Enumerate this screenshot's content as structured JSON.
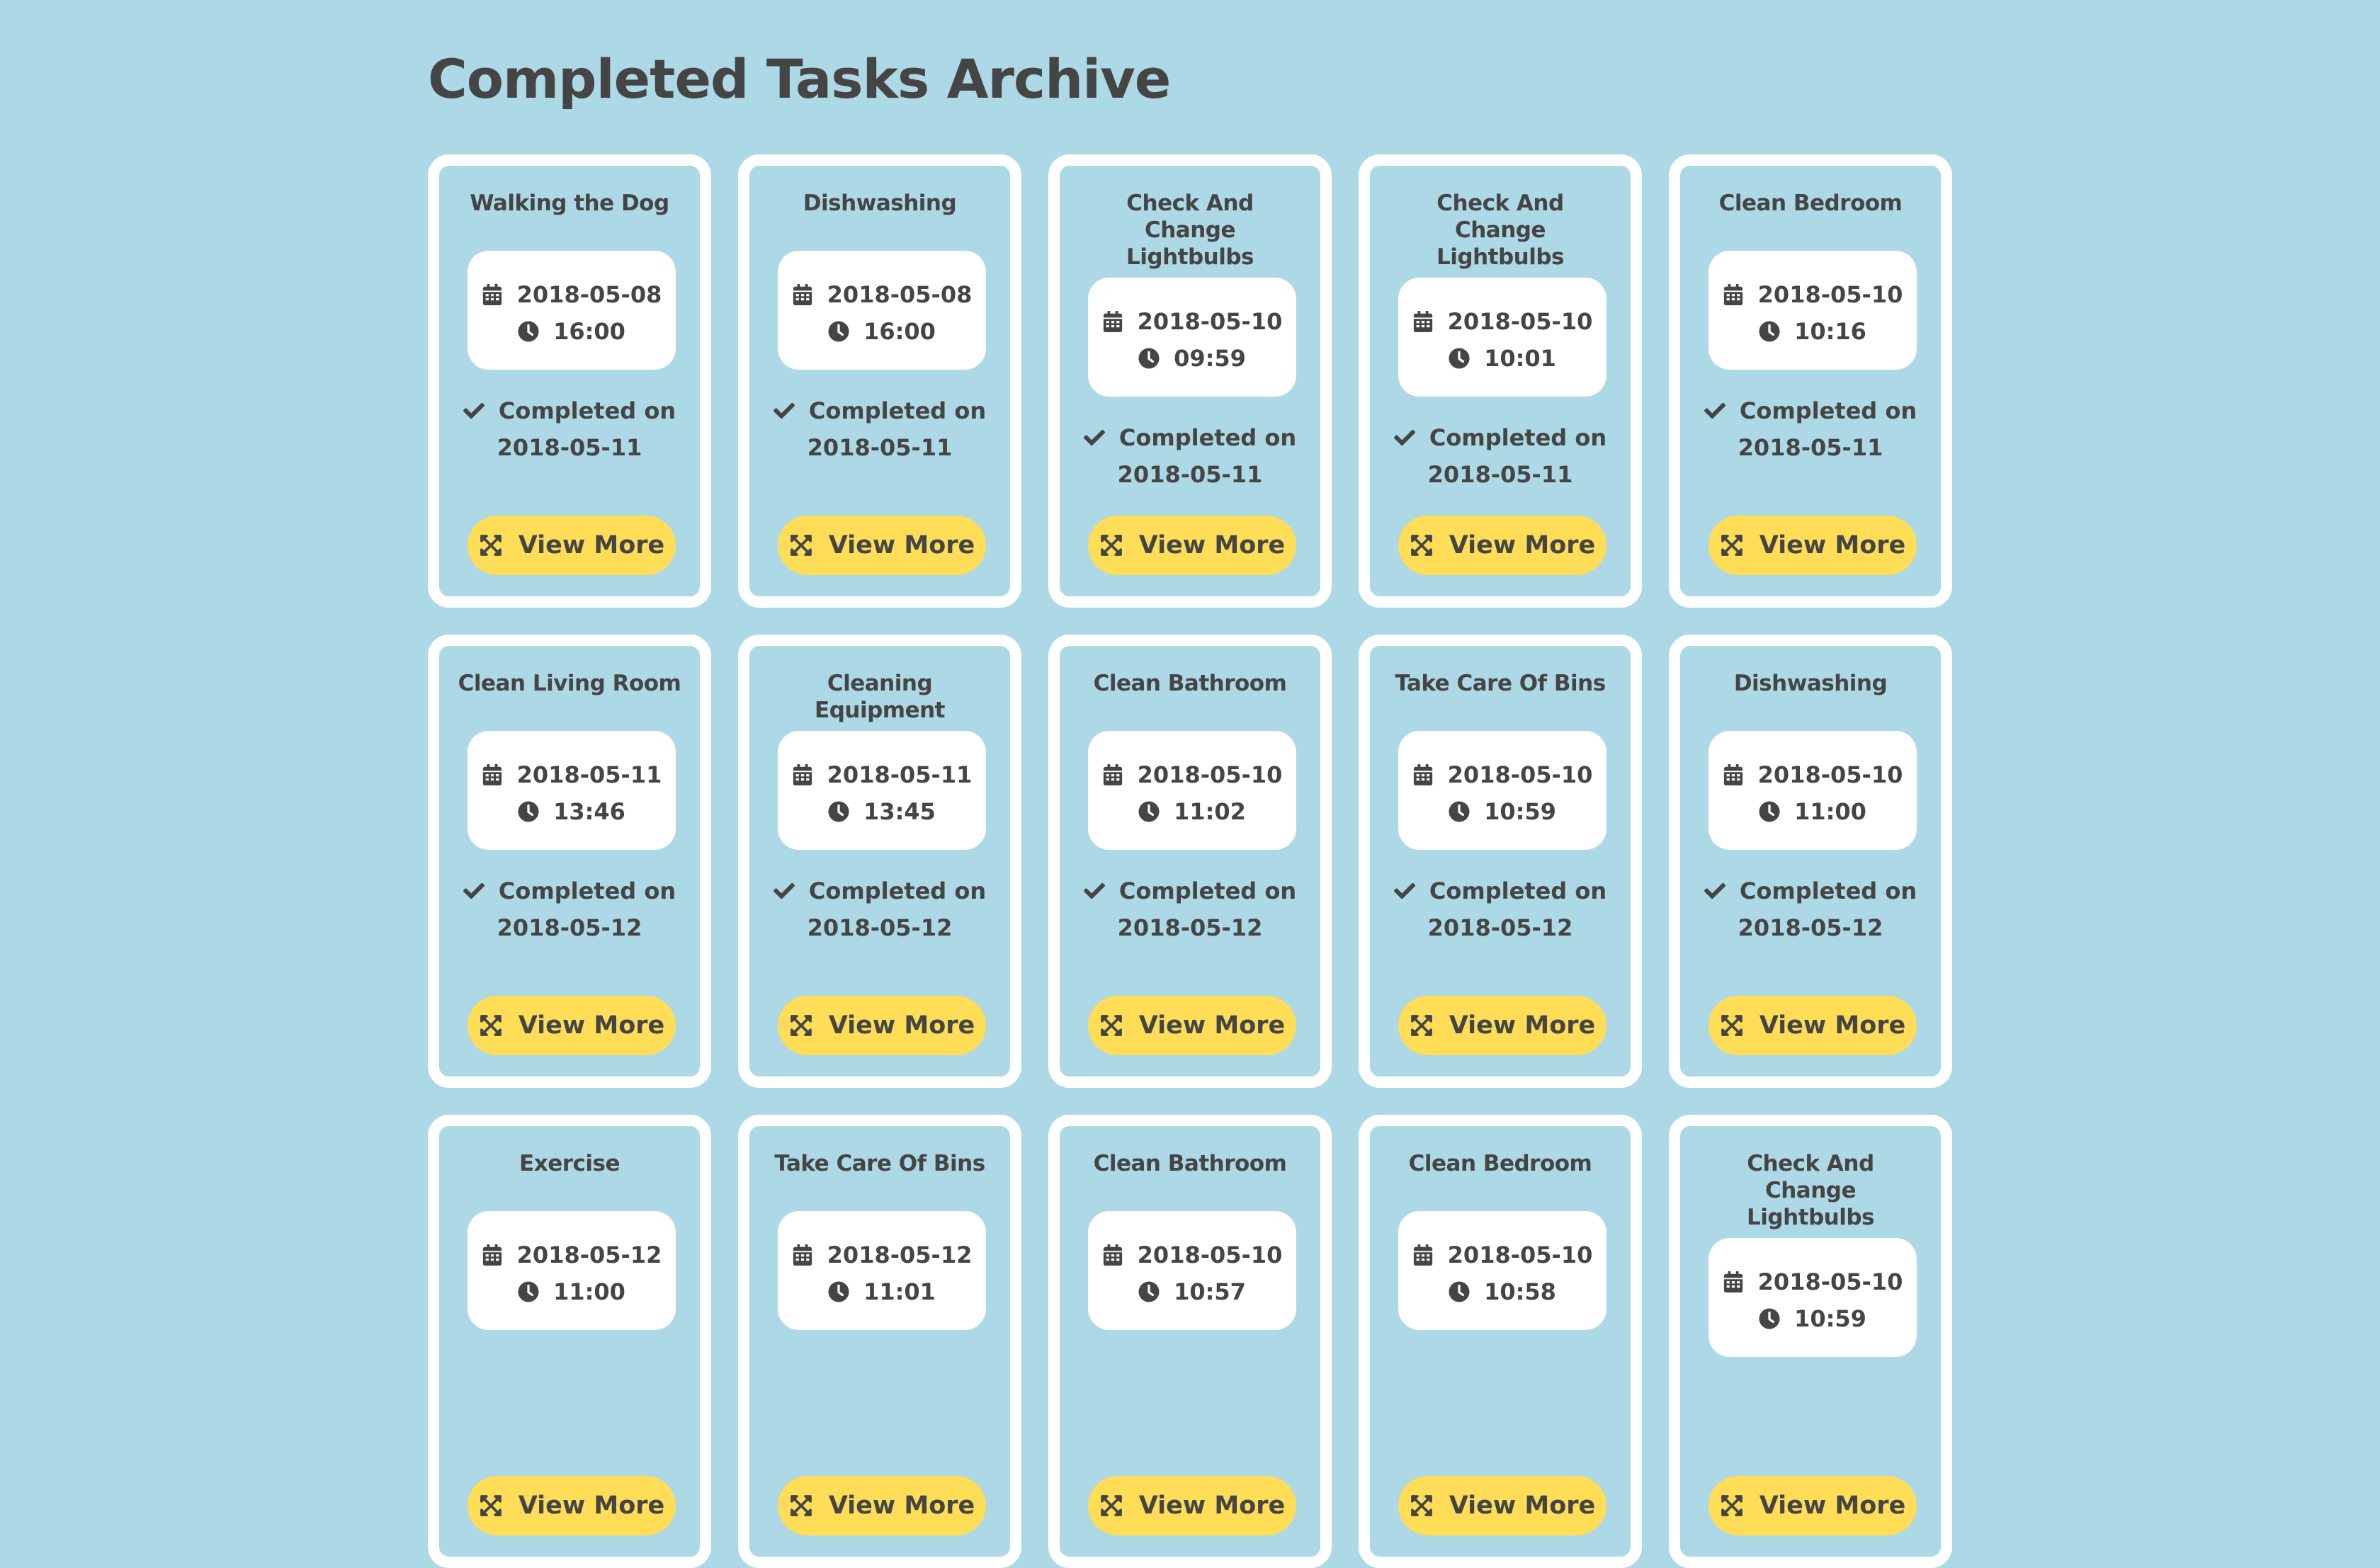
{
  "page": {
    "title": "Completed Tasks Archive",
    "completed_prefix": "Completed on",
    "button_label": "View More"
  },
  "colors": {
    "background": "#add8e6",
    "card_border": "#ffffff",
    "button": "#ffdd57",
    "text": "#454545"
  },
  "icons": {
    "date": "calendar-icon",
    "time": "clock-icon",
    "completed": "check-icon",
    "button": "expand-icon"
  },
  "tasks": [
    {
      "title": "Walking the Dog",
      "date": "2018-05-08",
      "time": "16:00",
      "completed": "2018-05-11"
    },
    {
      "title": "Dishwashing",
      "date": "2018-05-08",
      "time": "16:00",
      "completed": "2018-05-11"
    },
    {
      "title": "Check And Change Lightbulbs",
      "date": "2018-05-10",
      "time": "09:59",
      "completed": "2018-05-11"
    },
    {
      "title": "Check And Change Lightbulbs",
      "date": "2018-05-10",
      "time": "10:01",
      "completed": "2018-05-11"
    },
    {
      "title": "Clean Bedroom",
      "date": "2018-05-10",
      "time": "10:16",
      "completed": "2018-05-11"
    },
    {
      "title": "Clean Living Room",
      "date": "2018-05-11",
      "time": "13:46",
      "completed": "2018-05-12"
    },
    {
      "title": "Cleaning Equipment",
      "date": "2018-05-11",
      "time": "13:45",
      "completed": "2018-05-12"
    },
    {
      "title": "Clean Bathroom",
      "date": "2018-05-10",
      "time": "11:02",
      "completed": "2018-05-12"
    },
    {
      "title": "Take Care Of Bins",
      "date": "2018-05-10",
      "time": "10:59",
      "completed": "2018-05-12"
    },
    {
      "title": "Dishwashing",
      "date": "2018-05-10",
      "time": "11:00",
      "completed": "2018-05-12"
    },
    {
      "title": "Exercise",
      "date": "2018-05-12",
      "time": "11:00",
      "completed": ""
    },
    {
      "title": "Take Care Of Bins",
      "date": "2018-05-12",
      "time": "11:01",
      "completed": ""
    },
    {
      "title": "Clean Bathroom",
      "date": "2018-05-10",
      "time": "10:57",
      "completed": ""
    },
    {
      "title": "Clean Bedroom",
      "date": "2018-05-10",
      "time": "10:58",
      "completed": ""
    },
    {
      "title": "Check And Change Lightbulbs",
      "date": "2018-05-10",
      "time": "10:59",
      "completed": ""
    }
  ]
}
